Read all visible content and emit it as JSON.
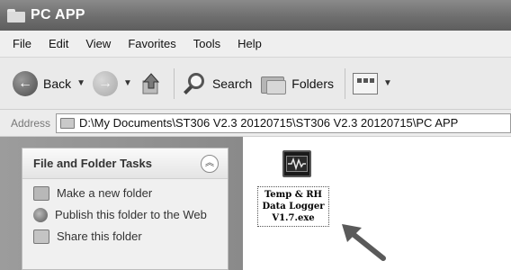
{
  "window": {
    "title": "PC APP"
  },
  "menu": [
    "File",
    "Edit",
    "View",
    "Favorites",
    "Tools",
    "Help"
  ],
  "toolbar": {
    "back_label": "Back",
    "search_label": "Search",
    "folders_label": "Folders"
  },
  "address": {
    "label": "Address",
    "path": "D:\\My Documents\\ST306 V2.3 20120715\\ST306 V2.3 20120715\\PC APP"
  },
  "tasks": {
    "title": "File and Folder Tasks",
    "collapse_glyph": "︽",
    "items": [
      {
        "label": "Make a new folder",
        "icon": "new-folder-icon"
      },
      {
        "label": "Publish this folder to the Web",
        "icon": "globe-icon"
      },
      {
        "label": "Share this folder",
        "icon": "share-folder-icon"
      }
    ]
  },
  "files": [
    {
      "name_line1": "Temp & RH",
      "name_line2": "Data Logger",
      "name_line3": "V1.7.exe",
      "icon": "oscilloscope-app-icon"
    }
  ]
}
